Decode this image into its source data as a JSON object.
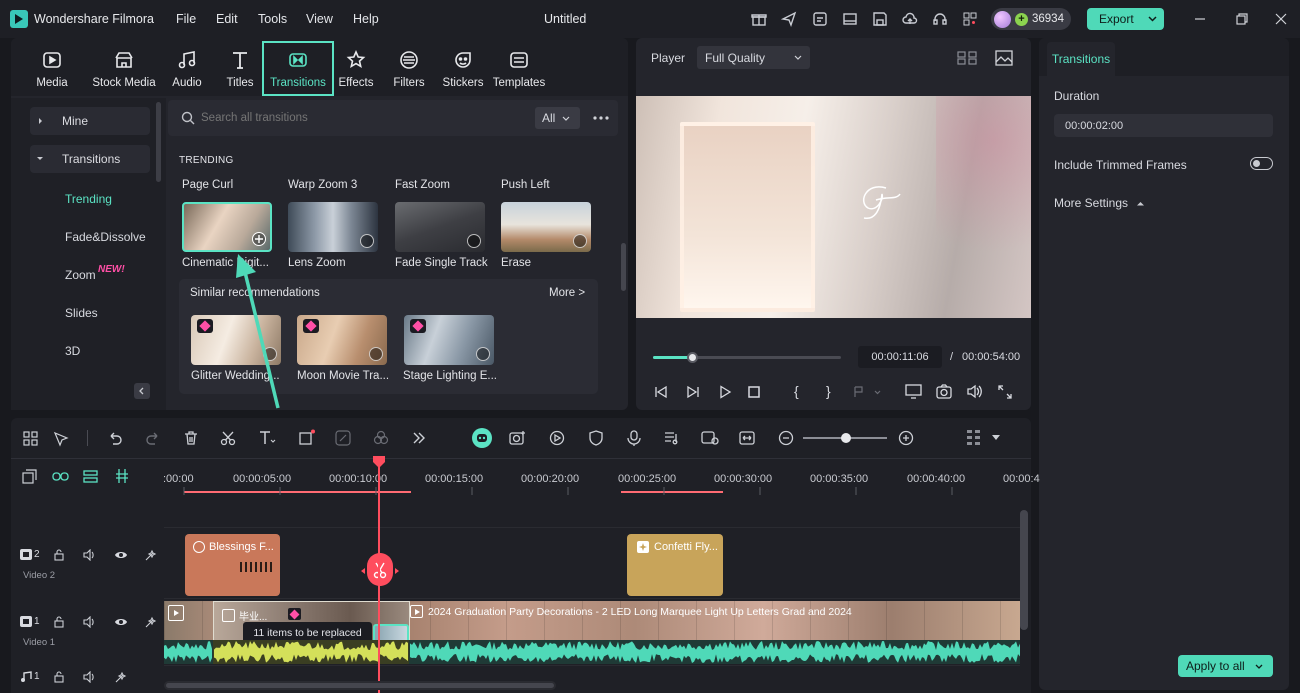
{
  "app": {
    "name": "Wondershare Filmora",
    "menu": [
      "File",
      "Edit",
      "Tools",
      "View",
      "Help"
    ],
    "project_title": "Untitled",
    "credits": "36934",
    "export_label": "Export"
  },
  "media_tabs": [
    {
      "label": "Media",
      "icon": "media-icon"
    },
    {
      "label": "Stock Media",
      "icon": "stock-media-icon"
    },
    {
      "label": "Audio",
      "icon": "audio-icon"
    },
    {
      "label": "Titles",
      "icon": "titles-icon"
    },
    {
      "label": "Transitions",
      "icon": "transitions-icon",
      "active": true
    },
    {
      "label": "Effects",
      "icon": "effects-icon"
    },
    {
      "label": "Filters",
      "icon": "filters-icon"
    },
    {
      "label": "Stickers",
      "icon": "stickers-icon"
    },
    {
      "label": "Templates",
      "icon": "templates-icon"
    }
  ],
  "sidebar": {
    "items": [
      {
        "label": "Mine"
      },
      {
        "label": "Transitions"
      },
      {
        "label": "Trending",
        "active": true
      },
      {
        "label": "Fade&Dissolve"
      },
      {
        "label": "Zoom"
      },
      {
        "label": "Slides"
      },
      {
        "label": "3D"
      }
    ],
    "new_badge": "NEW!"
  },
  "search": {
    "placeholder": "Search all transitions",
    "filter": "All"
  },
  "trending": {
    "heading": "TRENDING",
    "groups": [
      "Page Curl",
      "Warp Zoom 3",
      "Fast Zoom",
      "Push Left"
    ],
    "items": [
      "Cinematic Digit...",
      "Lens Zoom",
      "Fade Single Track",
      "Erase"
    ]
  },
  "similar": {
    "title": "Similar recommendations",
    "more": "More >",
    "items": [
      "Glitter Wedding...",
      "Moon Movie Tra...",
      "Stage Lighting E..."
    ]
  },
  "player": {
    "label": "Player",
    "quality": "Full Quality",
    "current_time": "00:00:11:06",
    "separator": "/",
    "total_time": "00:00:54:00",
    "progress": 0.21
  },
  "properties": {
    "tab": "Transitions",
    "duration_label": "Duration",
    "duration_value": "00:00:02:00",
    "include_trimmed": "Include Trimmed Frames",
    "more_settings": "More Settings",
    "apply_all": "Apply to all"
  },
  "timeline": {
    "ruler": [
      ":00:00",
      "00:00:05:00",
      "00:00:10:00",
      "00:00:15:00",
      "00:00:20:00",
      "00:00:25:00",
      "00:00:30:00",
      "00:00:35:00",
      "00:00:40:00",
      "00:00:4"
    ],
    "tracks": [
      {
        "num": "2",
        "name": "Video 2"
      },
      {
        "num": "1",
        "name": "Video 1"
      },
      {
        "num": "1",
        "name": ""
      }
    ],
    "clips": {
      "blessings": "Blessings F...",
      "confetti": "Confetti Fly...",
      "main": "2024 Graduation Party Decorations - 2 LED Long Marquee Light Up Letters Grad and 2024",
      "small": "毕业...",
      "tooltip": "11 items to be replaced"
    }
  },
  "colors": {
    "accent": "#5be3c4",
    "export": "#4fd9b8",
    "playhead": "#ff4d5e",
    "clip_orange": "#c9785a",
    "clip_gold": "#c8a45a"
  }
}
